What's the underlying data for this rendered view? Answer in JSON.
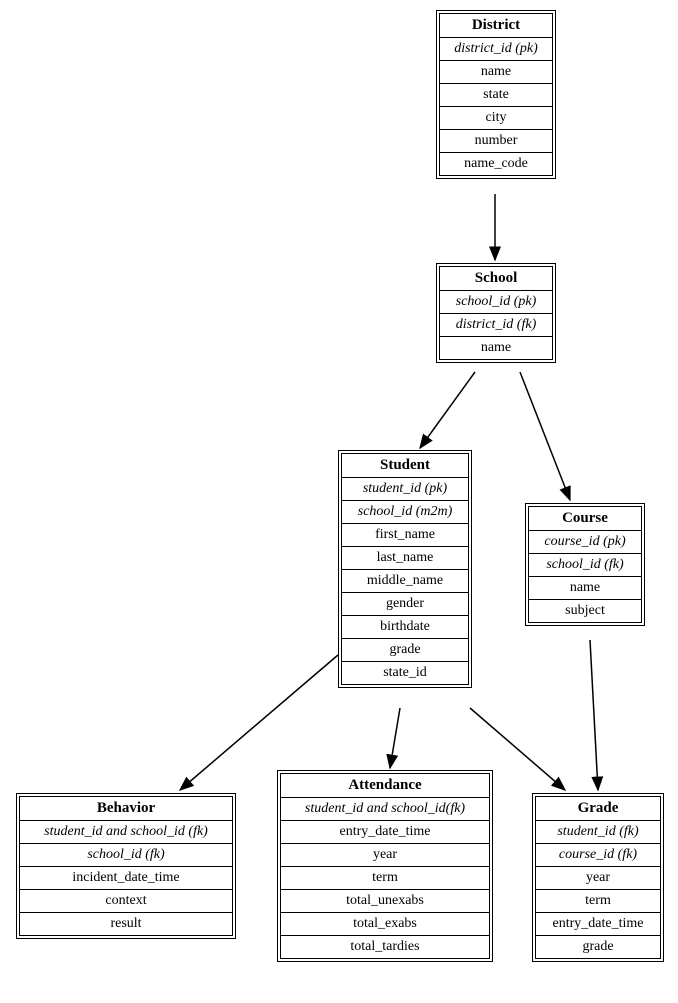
{
  "entities": {
    "district": {
      "title": "District",
      "fields": [
        {
          "text": "district_id (pk)",
          "italic": true
        },
        {
          "text": "name"
        },
        {
          "text": "state"
        },
        {
          "text": "city"
        },
        {
          "text": "number"
        },
        {
          "text": "name_code"
        }
      ]
    },
    "school": {
      "title": "School",
      "fields": [
        {
          "text": "school_id (pk)",
          "italic": true
        },
        {
          "text": "district_id (fk)",
          "italic": true
        },
        {
          "text": "name"
        }
      ]
    },
    "student": {
      "title": "Student",
      "fields": [
        {
          "text": "student_id (pk)",
          "italic": true
        },
        {
          "text": "school_id (m2m)",
          "italic": true
        },
        {
          "text": "first_name"
        },
        {
          "text": "last_name"
        },
        {
          "text": "middle_name"
        },
        {
          "text": "gender"
        },
        {
          "text": "birthdate"
        },
        {
          "text": "grade"
        },
        {
          "text": "state_id"
        }
      ]
    },
    "course": {
      "title": "Course",
      "fields": [
        {
          "text": "course_id (pk)",
          "italic": true
        },
        {
          "text": "school_id (fk)",
          "italic": true
        },
        {
          "text": "name"
        },
        {
          "text": "subject"
        }
      ]
    },
    "behavior": {
      "title": "Behavior",
      "fields": [
        {
          "text": "student_id and school_id (fk)",
          "italic": true
        },
        {
          "text": "school_id (fk)",
          "italic": true
        },
        {
          "text": "incident_date_time"
        },
        {
          "text": "context"
        },
        {
          "text": "result"
        }
      ]
    },
    "attendance": {
      "title": "Attendance",
      "fields": [
        {
          "text": "student_id and school_id(fk)",
          "italic": true
        },
        {
          "text": "entry_date_time"
        },
        {
          "text": "year"
        },
        {
          "text": "term"
        },
        {
          "text": "total_unexabs"
        },
        {
          "text": "total_exabs"
        },
        {
          "text": "total_tardies"
        }
      ]
    },
    "grade": {
      "title": "Grade",
      "fields": [
        {
          "text": "student_id (fk)",
          "italic": true
        },
        {
          "text": "course_id (fk)",
          "italic": true
        },
        {
          "text": "year"
        },
        {
          "text": "term"
        },
        {
          "text": "entry_date_time"
        },
        {
          "text": "grade"
        }
      ]
    }
  },
  "relationships": [
    {
      "from": "district",
      "to": "school"
    },
    {
      "from": "school",
      "to": "student"
    },
    {
      "from": "school",
      "to": "course"
    },
    {
      "from": "student",
      "to": "behavior"
    },
    {
      "from": "student",
      "to": "attendance"
    },
    {
      "from": "student",
      "to": "grade"
    },
    {
      "from": "course",
      "to": "grade"
    }
  ]
}
